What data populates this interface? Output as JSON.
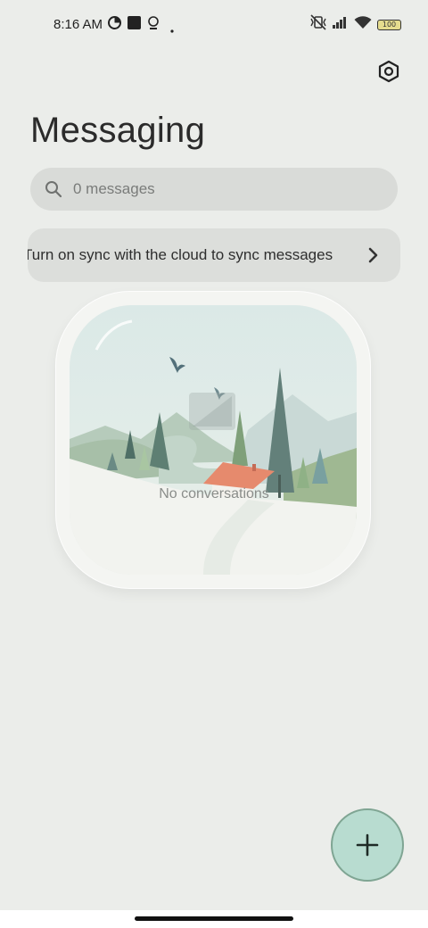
{
  "status_bar": {
    "time": "8:16 AM",
    "battery": "100",
    "icons": [
      "data-saver-icon",
      "stop-square-icon",
      "bulb-icon",
      "dot-icon",
      "mute-vibrate-icon",
      "signal-icon",
      "wifi-icon",
      "battery-icon"
    ]
  },
  "header": {
    "title": "Messaging",
    "settings_icon": "settings-hexagon-icon"
  },
  "search": {
    "placeholder": "0 messages",
    "icon": "search-icon"
  },
  "sync_banner": {
    "text": "Turn on sync with the cloud to sync messages",
    "icon": "chevron-right-icon"
  },
  "empty_state": {
    "text": "No conversations"
  },
  "fab": {
    "icon": "plus-icon"
  },
  "colors": {
    "background": "#ebedea",
    "search_bg": "#d9dbd8",
    "fab_fill": "#b8dcd0",
    "fab_border": "#7fa593"
  }
}
